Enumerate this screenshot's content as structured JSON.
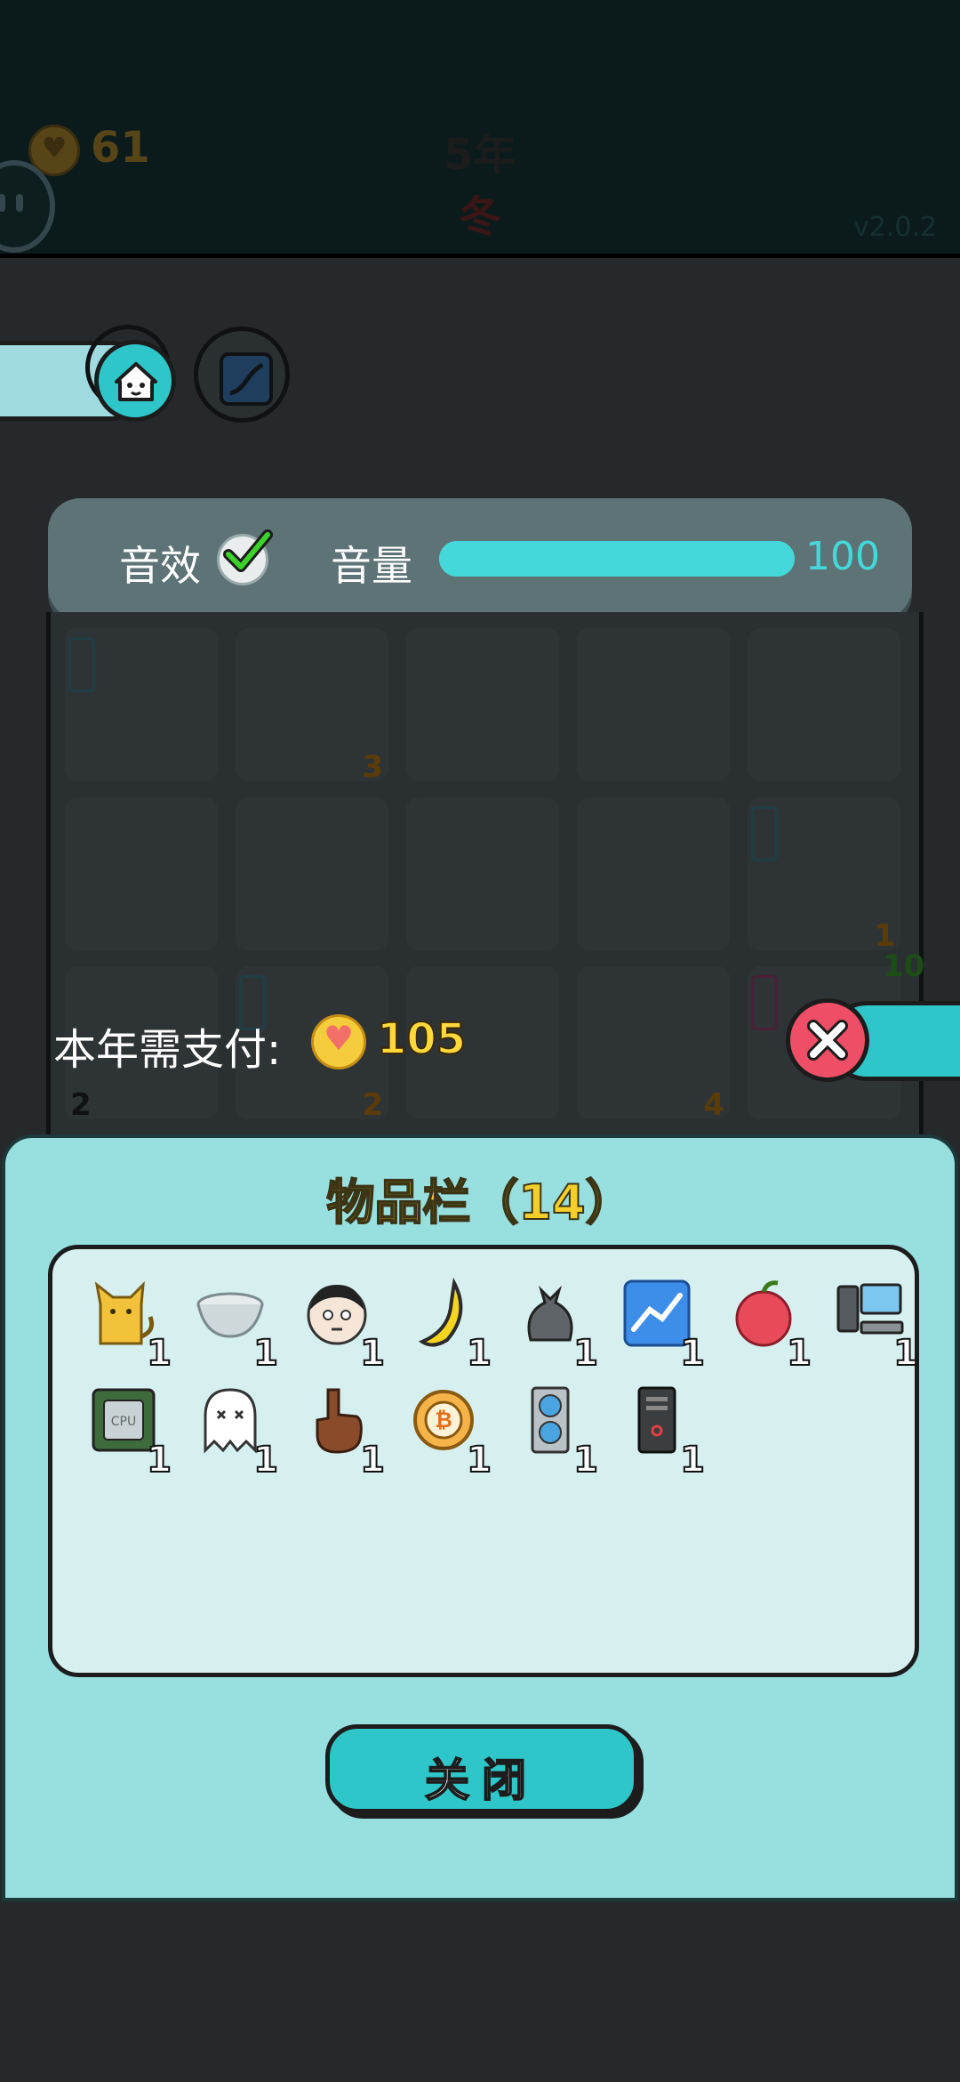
{
  "header": {
    "coins": "61",
    "year": "5年",
    "season": "冬",
    "version": "v2.0.2"
  },
  "settings": {
    "sfx_label": "音效",
    "sfx_enabled": true,
    "volume_label": "音量",
    "volume_value": "100",
    "volume_level": 1.0
  },
  "board": {
    "cells": [
      {
        "count": "",
        "tag": true
      },
      {
        "count": "3",
        "tag": false
      },
      {
        "count": "",
        "tag": false
      },
      {
        "count": "",
        "tag": false
      },
      {
        "count": "",
        "tag": false
      },
      {
        "count": "",
        "tag": false
      },
      {
        "count": "",
        "tag": false
      },
      {
        "count": "",
        "tag": false
      },
      {
        "count": "",
        "tag": false
      },
      {
        "count": "1",
        "tag": true
      },
      {
        "count": "2",
        "tag": false
      },
      {
        "count": "2",
        "tag": true
      },
      {
        "count": "",
        "tag": false
      },
      {
        "count": "4",
        "tag": false
      },
      {
        "count": "10",
        "tag": true
      }
    ]
  },
  "payment": {
    "label": "本年需支付:",
    "amount": "105"
  },
  "inventory": {
    "title": "物品栏（14）",
    "close_label": "关闭",
    "items": [
      {
        "icon": "cat-icon",
        "qty": "1"
      },
      {
        "icon": "bowl-icon",
        "qty": "1"
      },
      {
        "icon": "face-icon",
        "qty": "1"
      },
      {
        "icon": "banana-icon",
        "qty": "1"
      },
      {
        "icon": "trash-bag-icon",
        "qty": "1"
      },
      {
        "icon": "chart-icon",
        "qty": "1"
      },
      {
        "icon": "lychee-icon",
        "qty": "1"
      },
      {
        "icon": "computer-icon",
        "qty": "1"
      },
      {
        "icon": "cpu-icon",
        "qty": "1"
      },
      {
        "icon": "ghost-icon",
        "qty": "1"
      },
      {
        "icon": "finger-icon",
        "qty": "1"
      },
      {
        "icon": "bitcoin-pizza-icon",
        "qty": "1"
      },
      {
        "icon": "graphics-card-icon",
        "qty": "1"
      },
      {
        "icon": "server-icon",
        "qty": "1"
      }
    ]
  },
  "colors": {
    "accent": "#2ec6c9",
    "panel": "#98dfe0",
    "close_red": "#ef4f66",
    "coin_gold": "#f5cc3c"
  }
}
